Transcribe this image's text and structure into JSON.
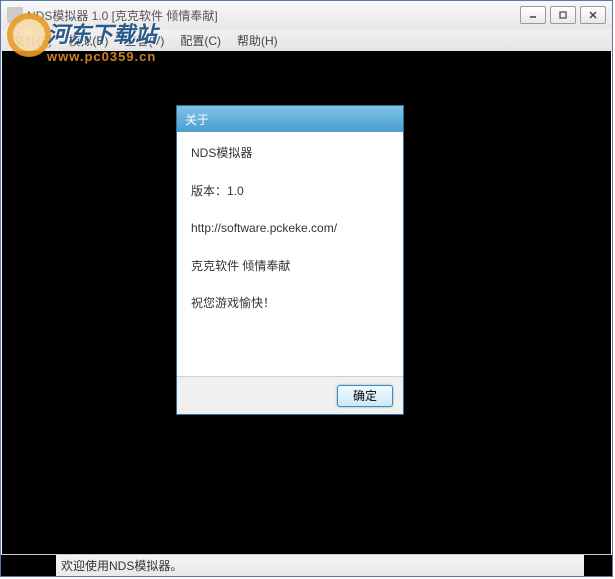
{
  "window": {
    "title": "NDS模拟器 1.0 [克克软件 倾情奉献]"
  },
  "menu": {
    "file": "文件(F)",
    "emulation": "模拟(E)",
    "view": "查看(V)",
    "config": "配置(C)",
    "help": "帮助(H)"
  },
  "watermark": {
    "site_cn": "河东下载站",
    "site_url": "www.pc0359.cn"
  },
  "status": {
    "text": "欢迎使用NDS模拟器。"
  },
  "about": {
    "title": "关于",
    "app_name": "NDS模拟器",
    "version_label": "版本：1.0",
    "url": "http://software.pckeke.com/",
    "credit": "克克软件 倾情奉献",
    "wish": "祝您游戏愉快！",
    "ok": "确定"
  }
}
